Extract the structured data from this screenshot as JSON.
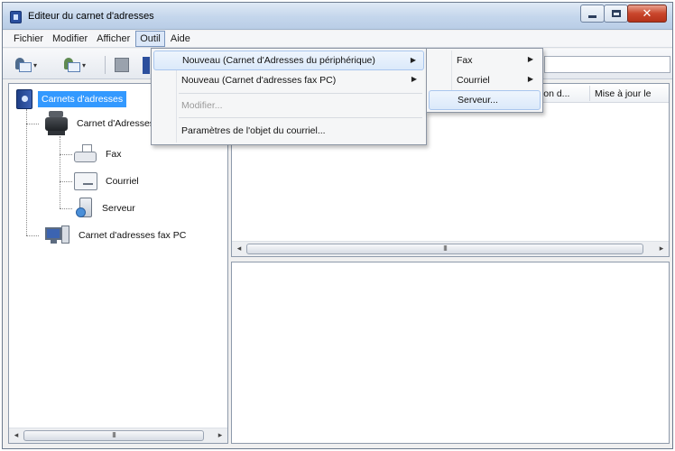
{
  "window": {
    "title": "Editeur du carnet d'adresses"
  },
  "menubar": {
    "items": [
      "Fichier",
      "Modifier",
      "Afficher",
      "Outil",
      "Aide"
    ],
    "active": "Outil"
  },
  "tree": {
    "root": "Carnets d'adresses",
    "device_book": "Carnet d'Adresses",
    "children": [
      "Fax",
      "Courriel",
      "Serveur"
    ],
    "pc_book": "Carnet d'adresses fax PC"
  },
  "list": {
    "columns": [
      "tion d...",
      "Mise à jour le"
    ]
  },
  "outil_menu": {
    "items": [
      {
        "label": "Nouveau (Carnet d'Adresses du périphérique)",
        "submenu": true,
        "enabled": true
      },
      {
        "label": "Nouveau (Carnet d'adresses fax PC)",
        "submenu": true,
        "enabled": true
      },
      {
        "label": "Modifier...",
        "submenu": false,
        "enabled": false
      },
      {
        "label": "Paramètres de l'objet du courriel...",
        "submenu": false,
        "enabled": true
      }
    ]
  },
  "nouveau_submenu": {
    "items": [
      {
        "label": "Fax",
        "submenu": true
      },
      {
        "label": "Courriel",
        "submenu": true
      },
      {
        "label": "Serveur...",
        "submenu": false
      }
    ]
  },
  "scrollbar": {
    "grip": "III"
  },
  "colors": {
    "selection": "#3399ff",
    "close_button": "#c9462c",
    "menu_highlight": "#dbe9fa"
  }
}
